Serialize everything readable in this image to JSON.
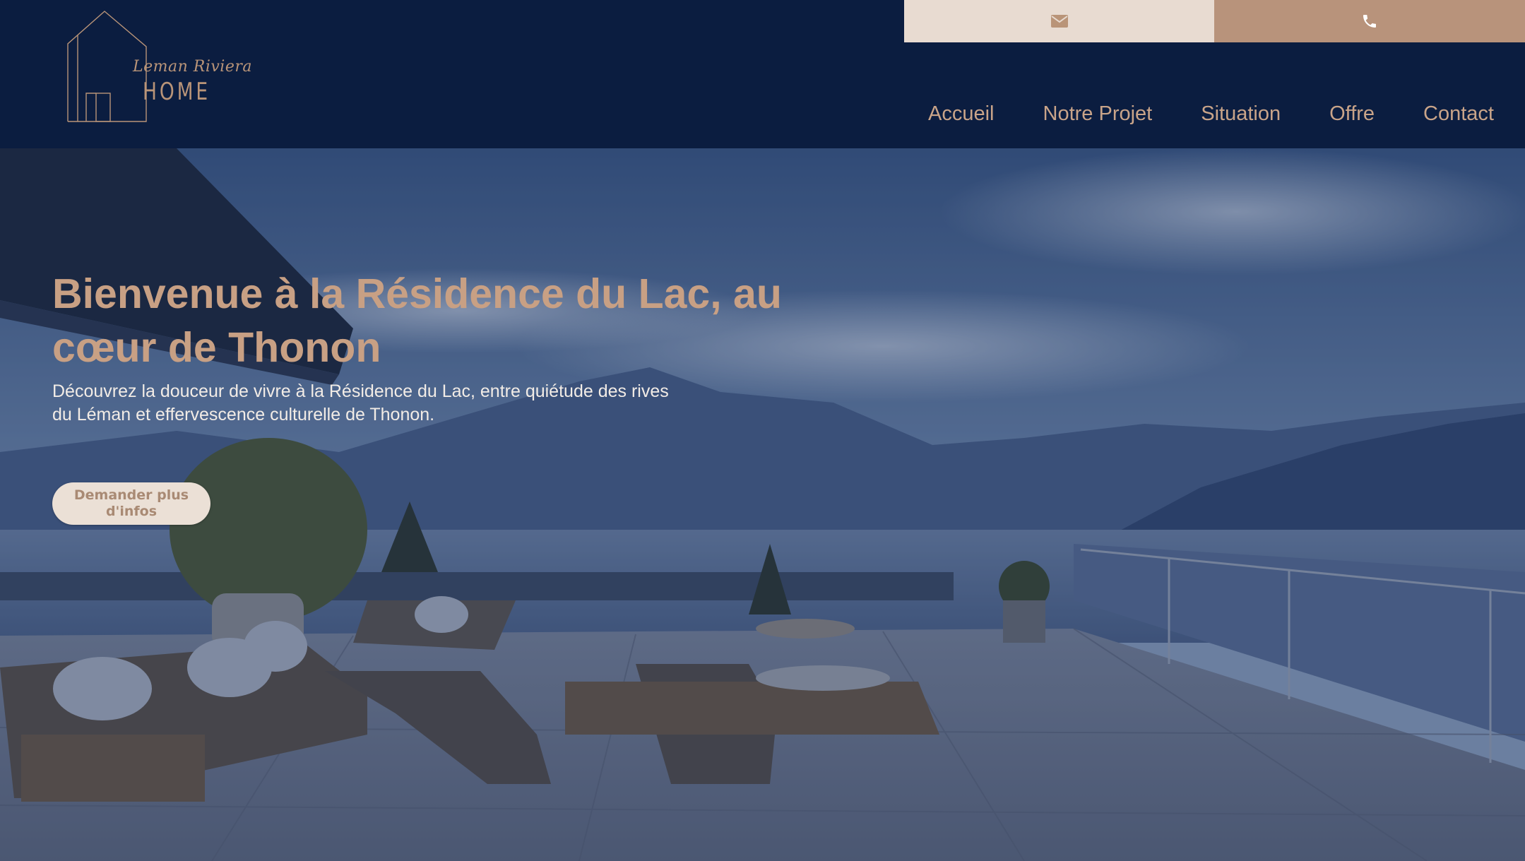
{
  "brand": {
    "script": "Leman Riviera",
    "name": "HOME"
  },
  "contact": {
    "email_icon": "envelope-icon",
    "phone_icon": "phone-icon"
  },
  "nav": {
    "items": [
      {
        "label": "Accueil"
      },
      {
        "label": "Notre Projet"
      },
      {
        "label": "Situation"
      },
      {
        "label": "Offre"
      },
      {
        "label": "Contact"
      }
    ]
  },
  "hero": {
    "title": "Bienvenue à la Résidence du Lac, au cœur de Thonon",
    "subtitle": "Découvrez la douceur de vivre à la Résidence du Lac, entre quiétude des rives du Léman et effervescence culturelle de Thonon.",
    "cta_label": "Demander plus d'infos"
  },
  "colors": {
    "header_bg": "#0b1d40",
    "accent": "#c8a084",
    "email_bg": "#e8dbd1",
    "phone_bg": "#b8937b",
    "cta_bg": "#ebe0d6"
  }
}
